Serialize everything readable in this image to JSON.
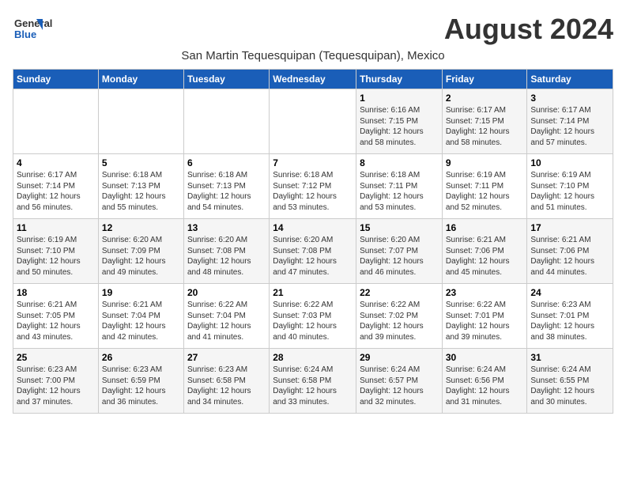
{
  "header": {
    "logo_line1": "General",
    "logo_line2": "Blue",
    "month_year": "August 2024",
    "subtitle": "San Martin Tequesquipan (Tequesquipan), Mexico"
  },
  "days_of_week": [
    "Sunday",
    "Monday",
    "Tuesday",
    "Wednesday",
    "Thursday",
    "Friday",
    "Saturday"
  ],
  "weeks": [
    [
      {
        "day": "",
        "info": ""
      },
      {
        "day": "",
        "info": ""
      },
      {
        "day": "",
        "info": ""
      },
      {
        "day": "",
        "info": ""
      },
      {
        "day": "1",
        "info": "Sunrise: 6:16 AM\nSunset: 7:15 PM\nDaylight: 12 hours\nand 58 minutes."
      },
      {
        "day": "2",
        "info": "Sunrise: 6:17 AM\nSunset: 7:15 PM\nDaylight: 12 hours\nand 58 minutes."
      },
      {
        "day": "3",
        "info": "Sunrise: 6:17 AM\nSunset: 7:14 PM\nDaylight: 12 hours\nand 57 minutes."
      }
    ],
    [
      {
        "day": "4",
        "info": "Sunrise: 6:17 AM\nSunset: 7:14 PM\nDaylight: 12 hours\nand 56 minutes."
      },
      {
        "day": "5",
        "info": "Sunrise: 6:18 AM\nSunset: 7:13 PM\nDaylight: 12 hours\nand 55 minutes."
      },
      {
        "day": "6",
        "info": "Sunrise: 6:18 AM\nSunset: 7:13 PM\nDaylight: 12 hours\nand 54 minutes."
      },
      {
        "day": "7",
        "info": "Sunrise: 6:18 AM\nSunset: 7:12 PM\nDaylight: 12 hours\nand 53 minutes."
      },
      {
        "day": "8",
        "info": "Sunrise: 6:18 AM\nSunset: 7:11 PM\nDaylight: 12 hours\nand 53 minutes."
      },
      {
        "day": "9",
        "info": "Sunrise: 6:19 AM\nSunset: 7:11 PM\nDaylight: 12 hours\nand 52 minutes."
      },
      {
        "day": "10",
        "info": "Sunrise: 6:19 AM\nSunset: 7:10 PM\nDaylight: 12 hours\nand 51 minutes."
      }
    ],
    [
      {
        "day": "11",
        "info": "Sunrise: 6:19 AM\nSunset: 7:10 PM\nDaylight: 12 hours\nand 50 minutes."
      },
      {
        "day": "12",
        "info": "Sunrise: 6:20 AM\nSunset: 7:09 PM\nDaylight: 12 hours\nand 49 minutes."
      },
      {
        "day": "13",
        "info": "Sunrise: 6:20 AM\nSunset: 7:08 PM\nDaylight: 12 hours\nand 48 minutes."
      },
      {
        "day": "14",
        "info": "Sunrise: 6:20 AM\nSunset: 7:08 PM\nDaylight: 12 hours\nand 47 minutes."
      },
      {
        "day": "15",
        "info": "Sunrise: 6:20 AM\nSunset: 7:07 PM\nDaylight: 12 hours\nand 46 minutes."
      },
      {
        "day": "16",
        "info": "Sunrise: 6:21 AM\nSunset: 7:06 PM\nDaylight: 12 hours\nand 45 minutes."
      },
      {
        "day": "17",
        "info": "Sunrise: 6:21 AM\nSunset: 7:06 PM\nDaylight: 12 hours\nand 44 minutes."
      }
    ],
    [
      {
        "day": "18",
        "info": "Sunrise: 6:21 AM\nSunset: 7:05 PM\nDaylight: 12 hours\nand 43 minutes."
      },
      {
        "day": "19",
        "info": "Sunrise: 6:21 AM\nSunset: 7:04 PM\nDaylight: 12 hours\nand 42 minutes."
      },
      {
        "day": "20",
        "info": "Sunrise: 6:22 AM\nSunset: 7:04 PM\nDaylight: 12 hours\nand 41 minutes."
      },
      {
        "day": "21",
        "info": "Sunrise: 6:22 AM\nSunset: 7:03 PM\nDaylight: 12 hours\nand 40 minutes."
      },
      {
        "day": "22",
        "info": "Sunrise: 6:22 AM\nSunset: 7:02 PM\nDaylight: 12 hours\nand 39 minutes."
      },
      {
        "day": "23",
        "info": "Sunrise: 6:22 AM\nSunset: 7:01 PM\nDaylight: 12 hours\nand 39 minutes."
      },
      {
        "day": "24",
        "info": "Sunrise: 6:23 AM\nSunset: 7:01 PM\nDaylight: 12 hours\nand 38 minutes."
      }
    ],
    [
      {
        "day": "25",
        "info": "Sunrise: 6:23 AM\nSunset: 7:00 PM\nDaylight: 12 hours\nand 37 minutes."
      },
      {
        "day": "26",
        "info": "Sunrise: 6:23 AM\nSunset: 6:59 PM\nDaylight: 12 hours\nand 36 minutes."
      },
      {
        "day": "27",
        "info": "Sunrise: 6:23 AM\nSunset: 6:58 PM\nDaylight: 12 hours\nand 34 minutes."
      },
      {
        "day": "28",
        "info": "Sunrise: 6:24 AM\nSunset: 6:58 PM\nDaylight: 12 hours\nand 33 minutes."
      },
      {
        "day": "29",
        "info": "Sunrise: 6:24 AM\nSunset: 6:57 PM\nDaylight: 12 hours\nand 32 minutes."
      },
      {
        "day": "30",
        "info": "Sunrise: 6:24 AM\nSunset: 6:56 PM\nDaylight: 12 hours\nand 31 minutes."
      },
      {
        "day": "31",
        "info": "Sunrise: 6:24 AM\nSunset: 6:55 PM\nDaylight: 12 hours\nand 30 minutes."
      }
    ]
  ]
}
